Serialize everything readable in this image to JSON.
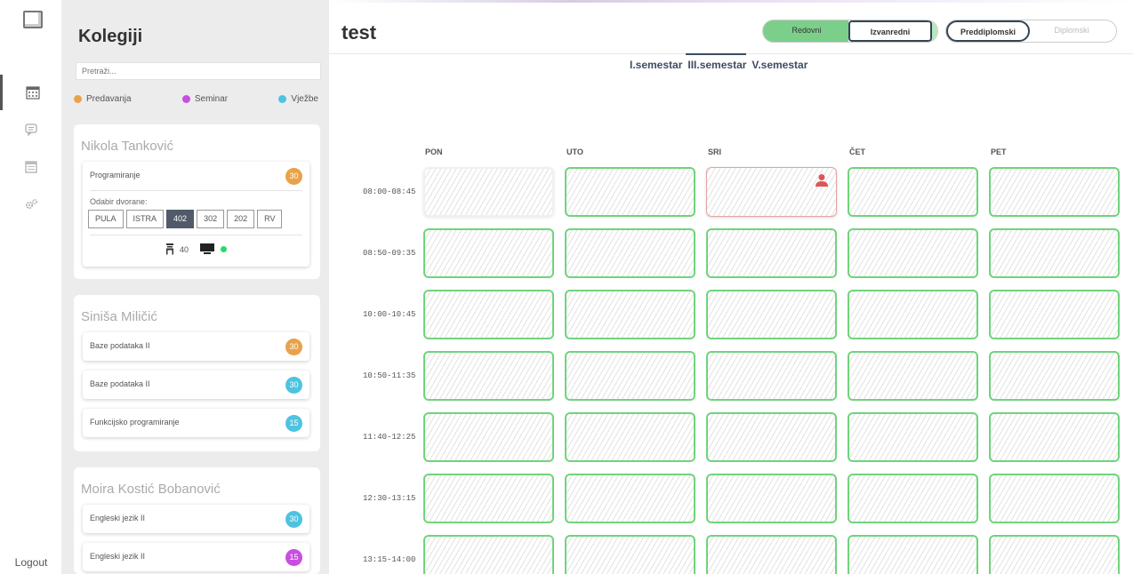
{
  "sidebar": {
    "logout": "Logout"
  },
  "panel": {
    "title": "Kolegiji",
    "search_placeholder": "Pretraži...",
    "legend": [
      {
        "label": "Predavanja",
        "color": "#e8a24a"
      },
      {
        "label": "Seminar",
        "color": "#c94ee0"
      },
      {
        "label": "Vježbe",
        "color": "#4ec3e0"
      }
    ],
    "teachers": [
      {
        "name": "Nikola Tanković",
        "courses": [
          {
            "name": "Programiranje",
            "count": "30",
            "type_color": "#e8a24a",
            "hall_label": "Odabir dvorane:",
            "halls": [
              "PULA",
              "ISTRA",
              "402",
              "302",
              "202",
              "RV"
            ],
            "selected_hall": "402",
            "seats": "40",
            "status_color": "#22dd66"
          }
        ]
      },
      {
        "name": "Siniša Miličić",
        "courses": [
          {
            "name": "Baze podataka II",
            "count": "30",
            "type_color": "#e8a24a"
          },
          {
            "name": "Baze podataka II",
            "count": "30",
            "type_color": "#4ec3e0"
          },
          {
            "name": "Funkcijsko programiranje",
            "count": "15",
            "type_color": "#4ec3e0"
          }
        ]
      },
      {
        "name": "Moira Kostić Bobanović",
        "courses": [
          {
            "name": "Engleski jezik II",
            "count": "30",
            "type_color": "#4ec3e0"
          },
          {
            "name": "Engleski jezik II",
            "count": "15",
            "type_color": "#c94ee0"
          }
        ]
      }
    ]
  },
  "main": {
    "title": "test",
    "study_mode": {
      "options": [
        "Redovni",
        "Izvanredni"
      ],
      "selected": "Redovni"
    },
    "study_level": {
      "options": [
        "Preddiplomski",
        "Diplomski"
      ],
      "selected": "Preddiplomski"
    },
    "semesters": [
      "I.semestar",
      "III.semestar",
      "V.semestar"
    ],
    "active_semester": "III.semestar",
    "days": [
      "PON",
      "UTO",
      "SRI",
      "ČET",
      "PET"
    ],
    "times": [
      "08:00-08:45",
      "08:50-09:35",
      "10:00-10:45",
      "10:50-11:35",
      "11:40-12:25",
      "12:30-13:15",
      "13:15-14:00"
    ],
    "available_color": "#6fd47c",
    "occupied_color": "#e05555"
  }
}
